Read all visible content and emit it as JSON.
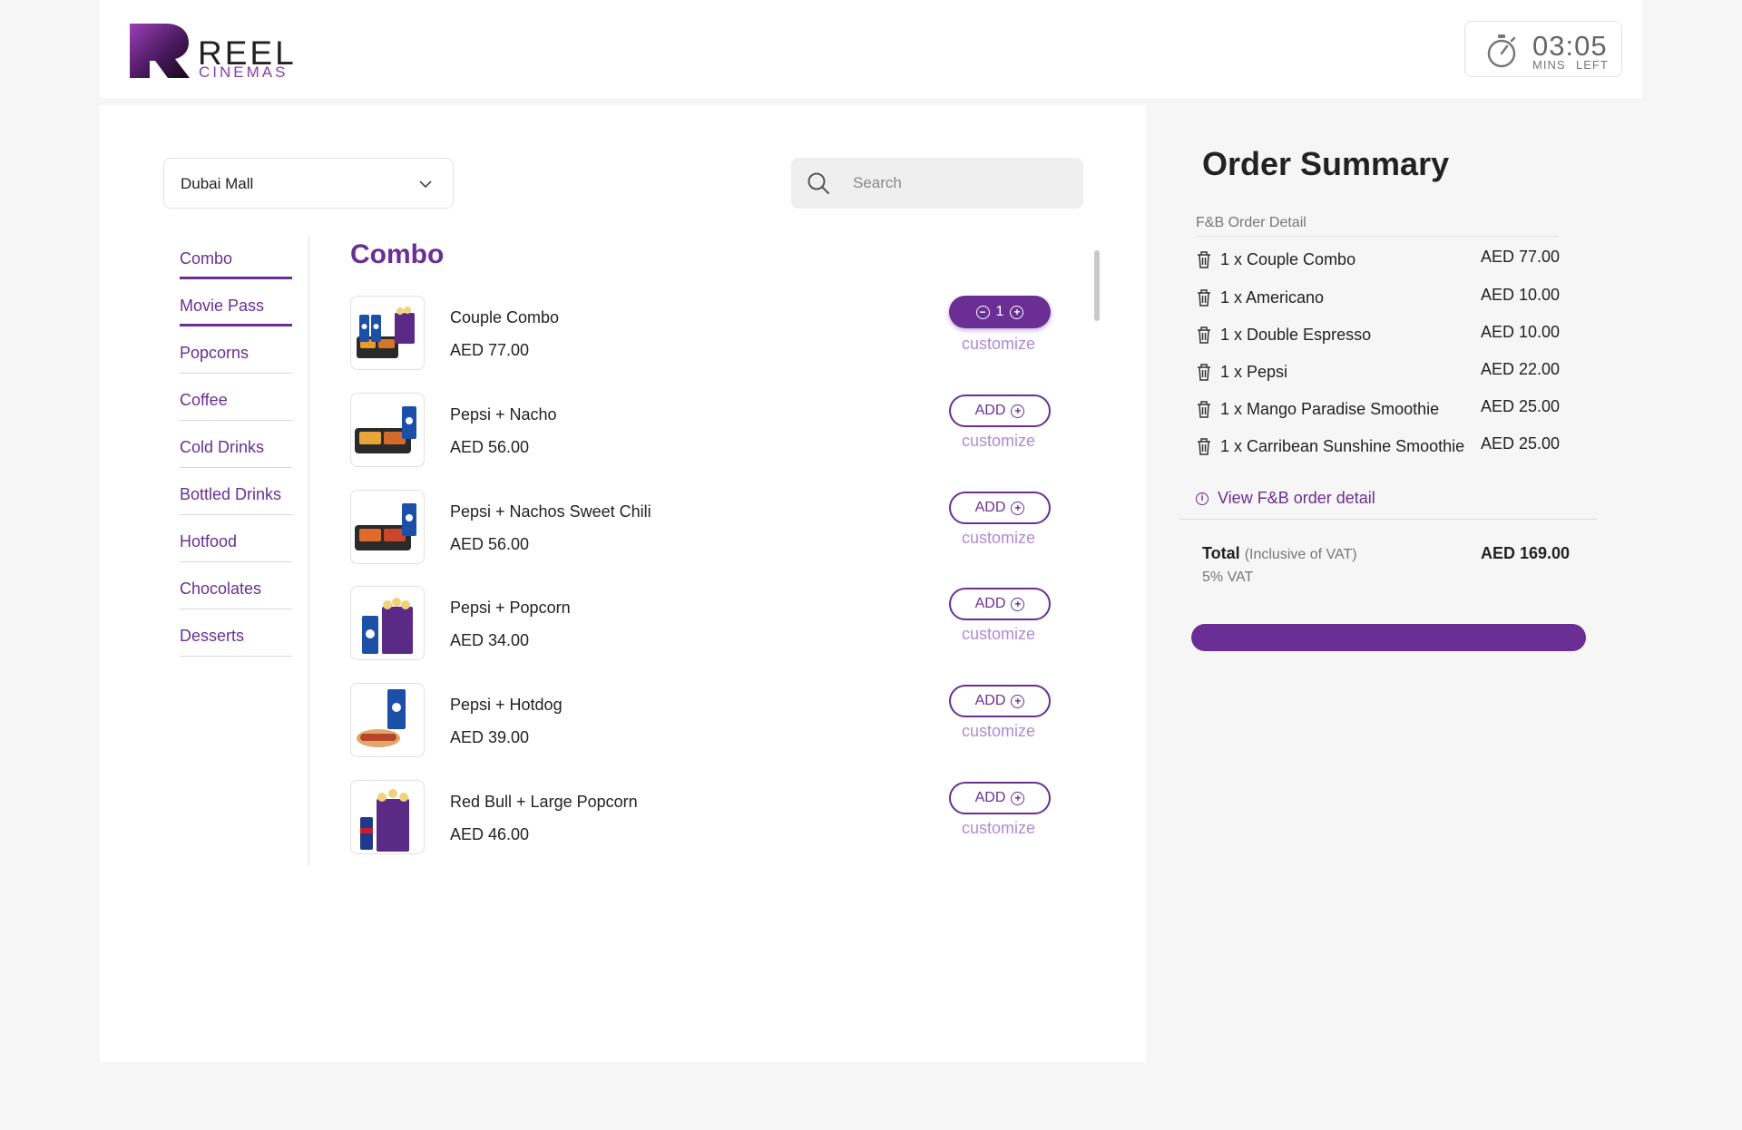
{
  "brand": {
    "name": "REEL",
    "sub": "CINEMAS"
  },
  "timer": {
    "time": "03:05",
    "mins_label": "MINS",
    "left_label": "LEFT"
  },
  "location": {
    "selected": "Dubai Mall"
  },
  "search": {
    "placeholder": "Search"
  },
  "categories": [
    {
      "label": "Combo"
    },
    {
      "label": "Movie Pass"
    },
    {
      "label": "Popcorns"
    },
    {
      "label": "Coffee"
    },
    {
      "label": "Cold Drinks"
    },
    {
      "label": "Bottled Drinks"
    },
    {
      "label": "Hotfood"
    },
    {
      "label": "Chocolates"
    },
    {
      "label": "Desserts"
    }
  ],
  "section": {
    "title": "Combo"
  },
  "products": [
    {
      "name": "Couple Combo",
      "price": "AED 77.00",
      "qty": "1",
      "customize": "customize"
    },
    {
      "name": "Pepsi + Nacho",
      "price": "AED 56.00",
      "add_label": "ADD",
      "customize": "customize"
    },
    {
      "name": "Pepsi + Nachos Sweet Chili",
      "price": "AED 56.00",
      "add_label": "ADD",
      "customize": "customize"
    },
    {
      "name": "Pepsi + Popcorn",
      "price": "AED 34.00",
      "add_label": "ADD",
      "customize": "customize"
    },
    {
      "name": "Pepsi + Hotdog",
      "price": "AED 39.00",
      "add_label": "ADD",
      "customize": "customize"
    },
    {
      "name": "Red Bull + Large Popcorn",
      "price": "AED 46.00",
      "add_label": "ADD",
      "customize": "customize"
    }
  ],
  "summary": {
    "title": "Order Summary",
    "detail_label": "F&B Order Detail",
    "items": [
      {
        "name": "1 x Couple Combo",
        "price": "AED 77.00"
      },
      {
        "name": "1 x Americano",
        "price": "AED 10.00"
      },
      {
        "name": "1 x Double Espresso",
        "price": "AED 10.00"
      },
      {
        "name": "1 x Pepsi",
        "price": "AED 22.00"
      },
      {
        "name": "1 x Mango Paradise Smoothie",
        "price": "AED 25.00"
      },
      {
        "name": "1 x Carribean Sunshine Smoothie",
        "price": "AED 25.00"
      }
    ],
    "view_detail": "View F&B order detail",
    "total_label": "Total",
    "total_note": "(Inclusive of VAT)",
    "vat_label": "5% VAT",
    "total_value": "AED 169.00"
  },
  "colors": {
    "brand_purple": "#6a2e94",
    "customize_lilac": "#b18ad3"
  }
}
